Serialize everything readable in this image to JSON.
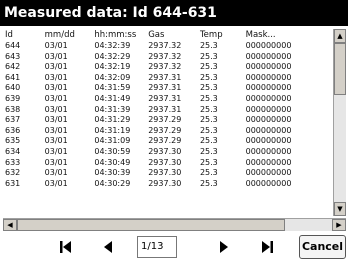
{
  "window": {
    "title": "Measured data: Id 644-631"
  },
  "table": {
    "columns": [
      "Id",
      "mm/dd",
      "hh:mm:ss",
      "Gas",
      "Temp",
      "Mask..."
    ],
    "rows": [
      [
        "644",
        "03/01",
        "04:32:39",
        "2937.32",
        "25.3",
        "000000000"
      ],
      [
        "643",
        "03/01",
        "04:32:29",
        "2937.32",
        "25.3",
        "000000000"
      ],
      [
        "642",
        "03/01",
        "04:32:19",
        "2937.32",
        "25.3",
        "000000000"
      ],
      [
        "641",
        "03/01",
        "04:32:09",
        "2937.31",
        "25.3",
        "000000000"
      ],
      [
        "640",
        "03/01",
        "04:31:59",
        "2937.31",
        "25.3",
        "000000000"
      ],
      [
        "639",
        "03/01",
        "04:31:49",
        "2937.31",
        "25.3",
        "000000000"
      ],
      [
        "638",
        "03/01",
        "04:31:39",
        "2937.31",
        "25.3",
        "000000000"
      ],
      [
        "637",
        "03/01",
        "04:31:29",
        "2937.29",
        "25.3",
        "000000000"
      ],
      [
        "636",
        "03/01",
        "04:31:19",
        "2937.29",
        "25.3",
        "000000000"
      ],
      [
        "635",
        "03/01",
        "04:31:09",
        "2937.29",
        "25.3",
        "000000000"
      ],
      [
        "634",
        "03/01",
        "04:30:59",
        "2937.30",
        "25.3",
        "000000000"
      ],
      [
        "633",
        "03/01",
        "04:30:49",
        "2937.30",
        "25.3",
        "000000000"
      ],
      [
        "632",
        "03/01",
        "04:30:39",
        "2937.30",
        "25.3",
        "000000000"
      ],
      [
        "631",
        "03/01",
        "04:30:29",
        "2937.30",
        "25.3",
        "000000000"
      ]
    ]
  },
  "navigation": {
    "first_icon": "first-page-icon",
    "prev_icon": "previous-page-icon",
    "next_icon": "next-page-icon",
    "last_icon": "last-page-icon",
    "page_value": "1/13",
    "cancel_label": "Cancel"
  },
  "scrollbars": {
    "up_icon": "scroll-up-arrow-icon",
    "down_icon": "scroll-down-arrow-icon",
    "left_icon": "scroll-left-arrow-icon",
    "right_icon": "scroll-right-arrow-icon"
  }
}
